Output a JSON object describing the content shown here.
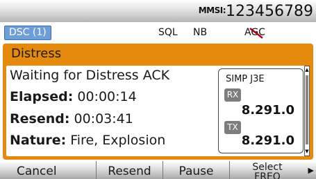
{
  "topbar": {
    "mmsi_label": "MMSI:",
    "mmsi_value": "123456789"
  },
  "status": {
    "dsc": "DSC (1)",
    "sql": "SQL",
    "nb": "NB",
    "agc": "AGC"
  },
  "panel": {
    "title": "Distress",
    "waiting": "Waiting for Distress ACK",
    "elapsed_label": "Elapsed:",
    "elapsed_value": "00:00:14",
    "resend_label": "Resend:",
    "resend_value": "00:03:41",
    "nature_label": "Nature:",
    "nature_value": "Fire, Explosion"
  },
  "freq": {
    "mode": "SIMP J3E",
    "rx_label": "RX",
    "rx_value": "8.291.0",
    "tx_label": "TX",
    "tx_value": "8.291.0"
  },
  "softkeys": {
    "cancel": "Cancel",
    "resend": "Resend",
    "pause": "Pause",
    "select_line1": "Select",
    "select_line2": "FREQ"
  },
  "colors": {
    "frame": "#e68a0e",
    "dsc_tag": "#6f9dd8"
  }
}
